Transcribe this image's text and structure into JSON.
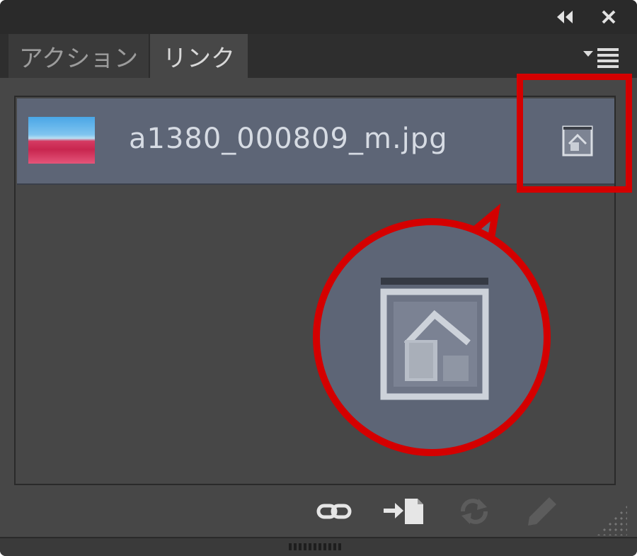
{
  "window": {
    "collapse_icon": "double-chevron-left-icon",
    "close_icon": "close-icon"
  },
  "tabs": [
    {
      "label": "アクション",
      "active": false
    },
    {
      "label": "リンク",
      "active": true
    }
  ],
  "panel_menu_icon": "panel-menu-icon",
  "links": [
    {
      "filename": "a1380_000809_m.jpg",
      "thumbnail": "pink-flower-field-photo",
      "status_icon": "embedded-icon"
    }
  ],
  "callout": {
    "highlight_color": "#d40000",
    "zoomed_icon": "embedded-icon"
  },
  "toolbar": {
    "buttons": [
      {
        "name": "relink-icon",
        "enabled": true
      },
      {
        "name": "go-to-link-icon",
        "enabled": true
      },
      {
        "name": "update-link-icon",
        "enabled": false
      },
      {
        "name": "edit-original-icon",
        "enabled": false
      }
    ]
  },
  "colors": {
    "panel_bg": "#474747",
    "row_selected": "#5d6576",
    "titlebar": "#2a2a2a"
  }
}
